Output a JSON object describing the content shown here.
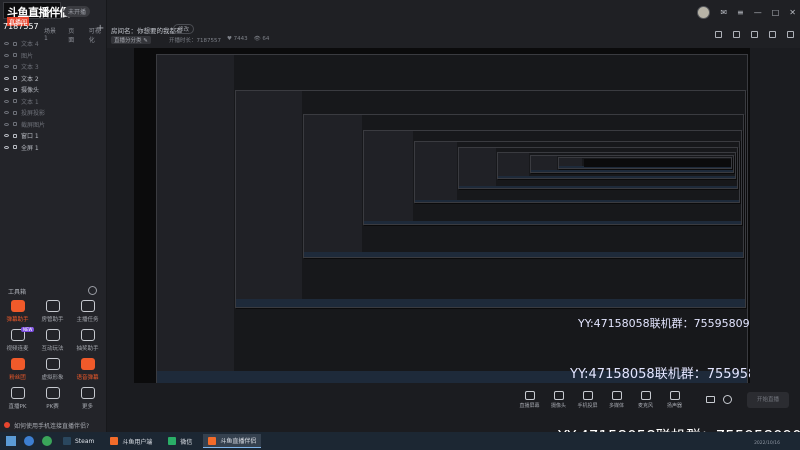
{
  "app": {
    "logo_text": "斗鱼直播伴侣",
    "status_pill": "未开播",
    "live_badge": "直播间",
    "room_id": "7187557"
  },
  "sidebar": {
    "tabs": [
      "场景1",
      "页面",
      "可视化"
    ],
    "add_icon": "plus-icon",
    "sources": [
      {
        "label": "文本 4",
        "visible": false
      },
      {
        "label": "图片",
        "visible": false
      },
      {
        "label": "文本 3",
        "visible": false
      },
      {
        "label": "文本 2",
        "visible": true
      },
      {
        "label": "摄像头",
        "visible": true
      },
      {
        "label": "文本 1",
        "visible": false
      },
      {
        "label": "投屏投影",
        "visible": false
      },
      {
        "label": "截屏图片",
        "visible": false
      },
      {
        "label": "窗口 1",
        "visible": true
      },
      {
        "label": "全屏 1",
        "visible": true
      }
    ],
    "tools_title": "工具箱",
    "tools": [
      {
        "label": "弹幕助手",
        "hot": true,
        "tag": ""
      },
      {
        "label": "房管助手",
        "hot": false,
        "tag": ""
      },
      {
        "label": "主播任务",
        "hot": false,
        "tag": ""
      },
      {
        "label": "视频连麦",
        "hot": false,
        "tag": "NEW"
      },
      {
        "label": "互动玩法",
        "hot": false,
        "tag": ""
      },
      {
        "label": "抽奖助手",
        "hot": false,
        "tag": ""
      },
      {
        "label": "粉丝团",
        "hot": true,
        "tag": ""
      },
      {
        "label": "虚拟形象",
        "hot": false,
        "tag": ""
      },
      {
        "label": "语音弹幕",
        "hot": true,
        "tag": ""
      },
      {
        "label": "直播PK",
        "hot": false,
        "tag": ""
      },
      {
        "label": "PK赛",
        "hot": false,
        "tag": ""
      },
      {
        "label": "更多",
        "hot": false,
        "tag": ""
      }
    ]
  },
  "header": {
    "title": "房间名：你想要的我都有",
    "edit_label": "修改",
    "category": "直播分分类 ✎",
    "stats": [
      "开播时长：7187557",
      "♥ 7443",
      "👁 64"
    ]
  },
  "preview": {
    "watermark_small": "YY:47158058联机群：755958090",
    "watermark_mid": "YY:47158058联机群：755958090"
  },
  "controls": [
    {
      "label": "直播屏幕",
      "icon": "screen-icon"
    },
    {
      "label": "摄像头",
      "icon": "camera-icon"
    },
    {
      "label": "手机投屏",
      "icon": "phone-icon"
    },
    {
      "label": "多媒体",
      "icon": "media-icon"
    },
    {
      "label": "麦克风",
      "icon": "mic-icon"
    },
    {
      "label": "扬声器",
      "icon": "speaker-icon"
    }
  ],
  "start_button": "开始直播",
  "watermark_main": "YY:47158058联机群：755958090",
  "notice": "如何使用手机连接直播伴侣?",
  "taskbar": {
    "apps": [
      {
        "label": "Steam",
        "color": "#2a475e",
        "active": false
      },
      {
        "label": "斗鱼用户端",
        "color": "#f26b2a",
        "active": false
      },
      {
        "label": "微信",
        "color": "#2aae67",
        "active": false
      },
      {
        "label": "斗鱼直播伴侣",
        "color": "#f26b2a",
        "active": true
      }
    ],
    "clock": "2022/10/16"
  },
  "colors": {
    "accent": "#f05a2a",
    "panel": "#232429",
    "preview_bg": "#0b0b0c"
  }
}
